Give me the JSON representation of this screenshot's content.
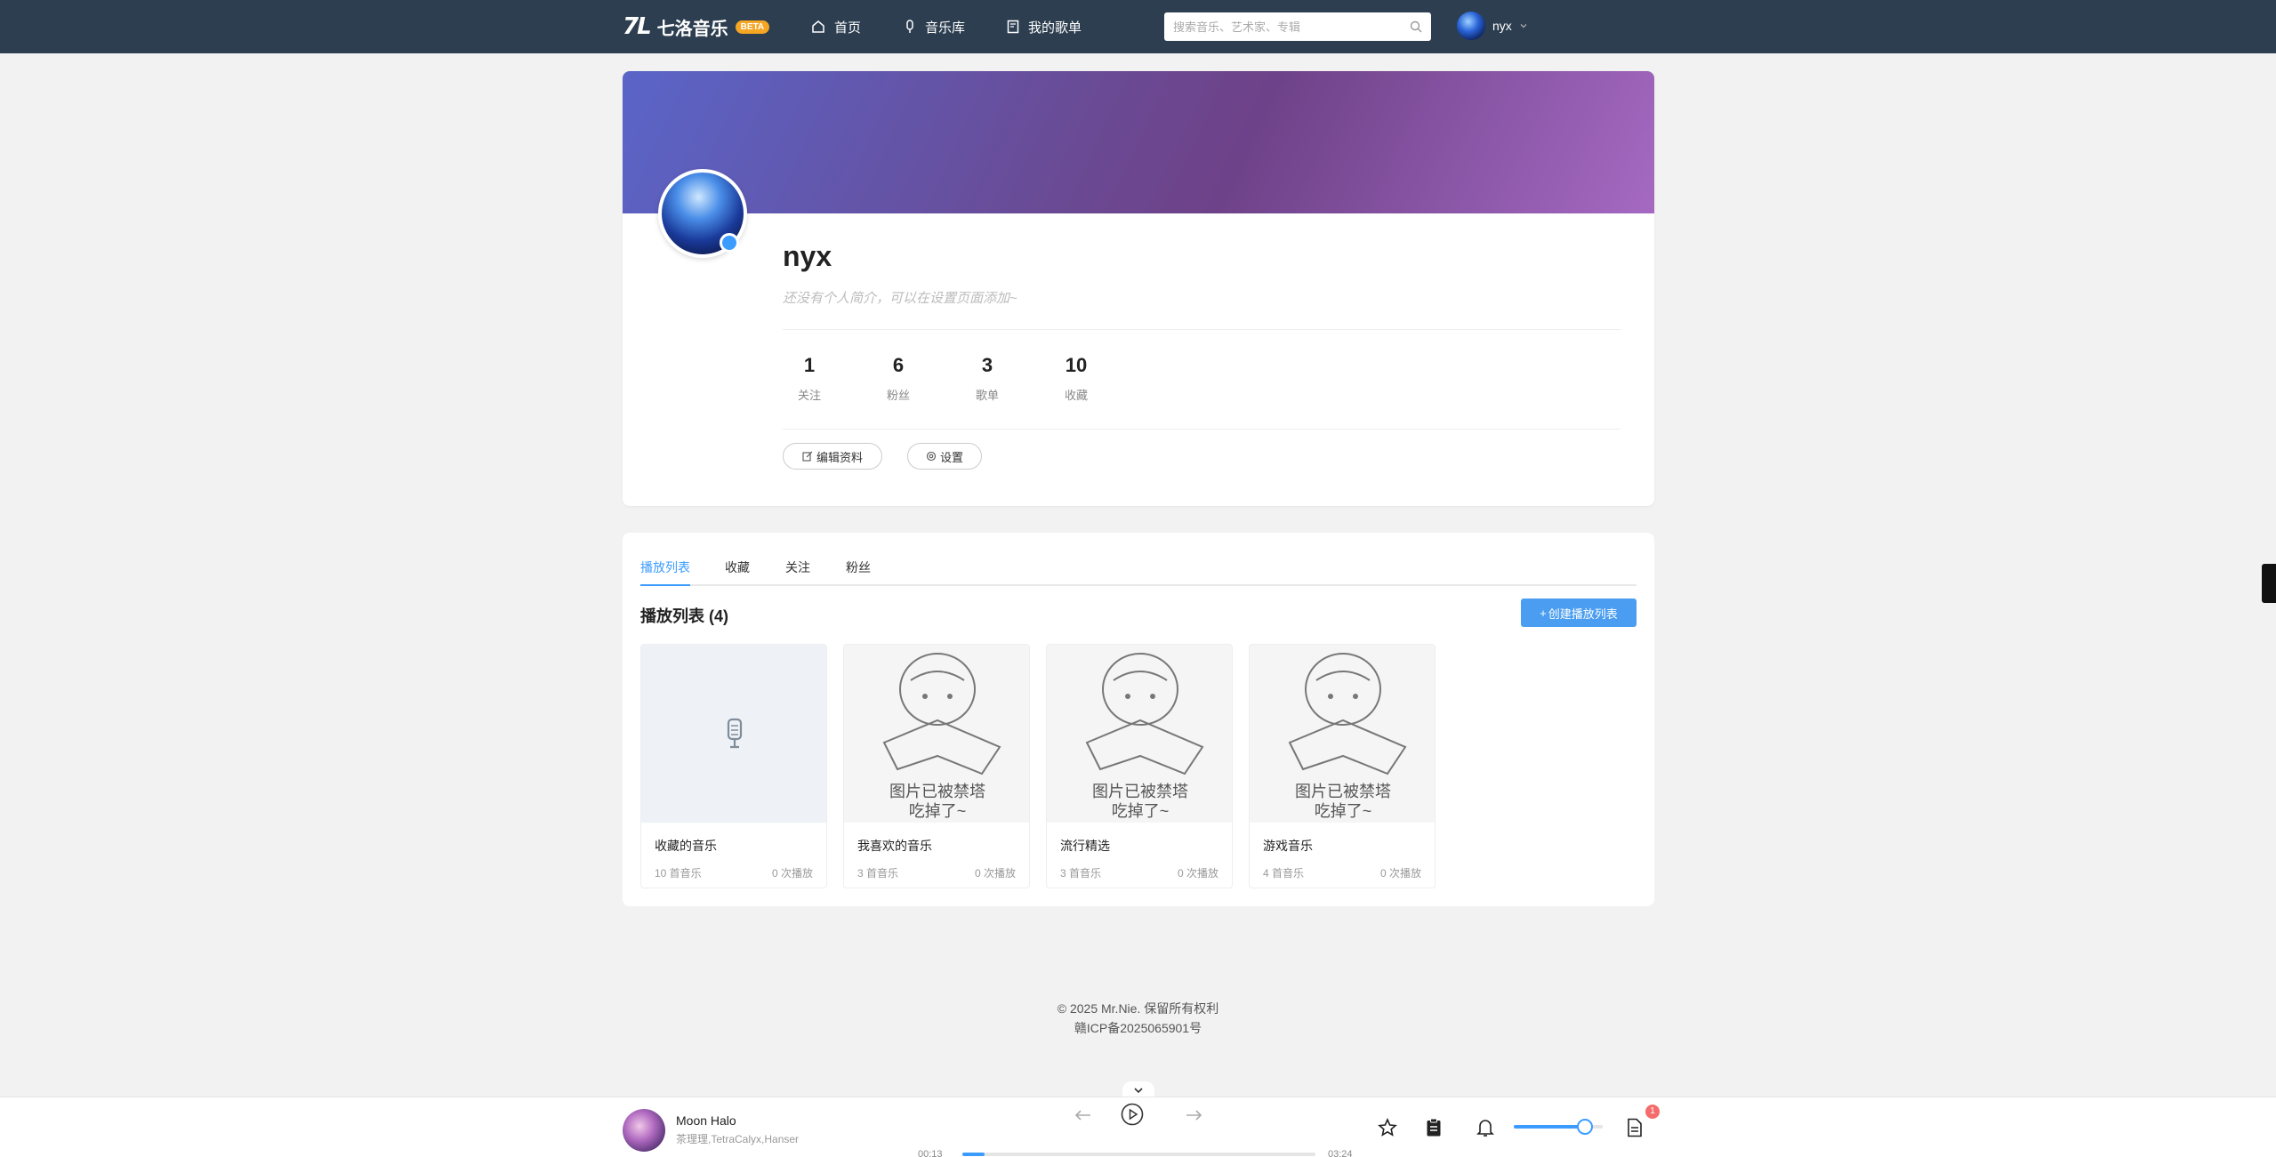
{
  "nav": {
    "logo_mark": "7L",
    "logo_text": "七洛音乐",
    "beta": "BETA",
    "items": [
      {
        "label": "首页",
        "icon": "home-icon"
      },
      {
        "label": "音乐库",
        "icon": "microphone-icon"
      },
      {
        "label": "我的歌单",
        "icon": "playlist-book-icon"
      }
    ],
    "search_placeholder": "搜索音乐、艺术家、专辑",
    "username": "nyx"
  },
  "profile": {
    "name": "nyx",
    "bio": "还没有个人简介，可以在设置页面添加~",
    "stats": [
      {
        "num": "1",
        "label": "关注"
      },
      {
        "num": "6",
        "label": "粉丝"
      },
      {
        "num": "3",
        "label": "歌单"
      },
      {
        "num": "10",
        "label": "收藏"
      }
    ],
    "edit_label": "编辑资料",
    "settings_label": "设置"
  },
  "tabs": [
    "播放列表",
    "收藏",
    "关注",
    "粉丝"
  ],
  "active_tab": 0,
  "section_title": "播放列表 (4)",
  "create_label": "创建播放列表",
  "playlists": [
    {
      "name": "收藏的音乐",
      "count": "10 首音乐",
      "plays": "0 次播放",
      "cover": "placeholder"
    },
    {
      "name": "我喜欢的音乐",
      "count": "3 首音乐",
      "plays": "0 次播放",
      "cover": "broken"
    },
    {
      "name": "流行精选",
      "count": "3 首音乐",
      "plays": "0 次播放",
      "cover": "broken"
    },
    {
      "name": "游戏音乐",
      "count": "4 首音乐",
      "plays": "0 次播放",
      "cover": "broken"
    }
  ],
  "broken_image_text": [
    "图片已被禁塔",
    "吃掉了~"
  ],
  "footer": {
    "copyright": "© 2025 Mr.Nie. 保留所有权利",
    "icp": "赣ICP备2025065901号"
  },
  "player": {
    "title": "Moon Halo",
    "artist": "茶理理,TetraCalyx,Hanser",
    "current_time": "00:13",
    "total_time": "03:24",
    "progress": 0.064,
    "volume": 0.8,
    "notification_count": "1"
  },
  "colors": {
    "accent": "#3b9bff",
    "nav_bg": "#2c3e50",
    "badge": "#f5a623"
  }
}
